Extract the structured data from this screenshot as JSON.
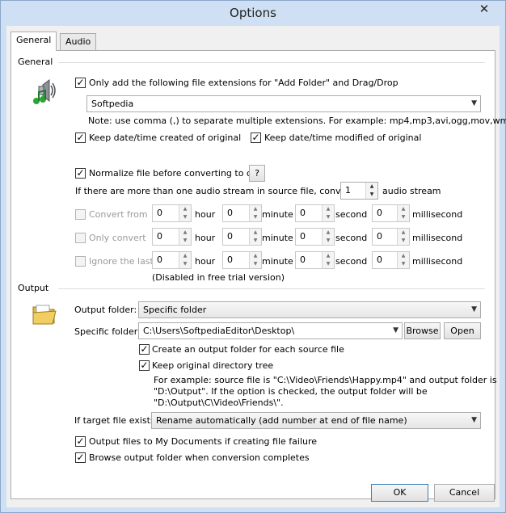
{
  "window": {
    "title": "Options",
    "close_glyph": "✕"
  },
  "tabs": [
    {
      "label": "General",
      "active": true
    },
    {
      "label": "Audio",
      "active": false
    }
  ],
  "general": {
    "section_label": "General",
    "icon": "speaker-music-icon",
    "only_add_ext_label": "Only add the following file extensions for \"Add Folder\" and Drag/Drop",
    "only_add_ext_checked": true,
    "extensions_value": "Softpedia",
    "ext_note": "Note: use comma (,) to separate multiple extensions. For example: mp4,mp3,avi,ogg,mov,wmv",
    "keep_created_label": "Keep date/time created of original",
    "keep_created_checked": true,
    "keep_modified_label": "Keep date/time modified of original",
    "keep_modified_checked": true,
    "normalize_label": "Normalize file before converting to one",
    "normalize_checked": true,
    "help_button": "?",
    "audio_stream_prefix": "If there are more than one audio stream in source file, converts no.",
    "audio_stream_value": "1",
    "audio_stream_suffix": "audio stream",
    "time_rows": [
      {
        "label": "Convert from",
        "checked": false
      },
      {
        "label": "Only convert",
        "checked": false
      },
      {
        "label": "Ignore the last",
        "checked": false
      }
    ],
    "time_units": {
      "hour": "hour",
      "minute": "minute",
      "second": "second",
      "millisecond": "millisecond"
    },
    "time_value": "0",
    "disabled_note": "(Disabled in free trial version)"
  },
  "output": {
    "section_label": "Output",
    "icon": "folder-icon",
    "output_folder_label": "Output folder:",
    "output_folder_value": "Specific folder",
    "specific_folder_label": "Specific folder:",
    "specific_folder_value": "C:\\Users\\SoftpediaEditor\\Desktop\\",
    "browse_button": "Browse",
    "open_button": "Open",
    "create_folder_label": "Create an output folder for each source file",
    "create_folder_checked": true,
    "keep_tree_label": "Keep original directory tree",
    "keep_tree_checked": true,
    "example_line1": "For example: source file is \"C:\\Video\\Friends\\Happy.mp4\" and output folder is",
    "example_line2": "\"D:\\Output\". If the option is checked, the output folder will be",
    "example_line3": "\"D:\\Output\\C\\Video\\Friends\\\".",
    "if_exists_label": "If target file exists",
    "if_exists_value": "Rename automatically (add number at end of file name)",
    "my_docs_label": "Output files to My Documents if creating file failure",
    "my_docs_checked": true,
    "browse_when_done_label": "Browse output folder when conversion completes",
    "browse_when_done_checked": true
  },
  "footer": {
    "ok_button": "OK",
    "cancel_button": "Cancel"
  },
  "glyphs": {
    "check": "✓",
    "dropdown": "▼",
    "spin_up": "▲",
    "spin_down": "▼"
  }
}
